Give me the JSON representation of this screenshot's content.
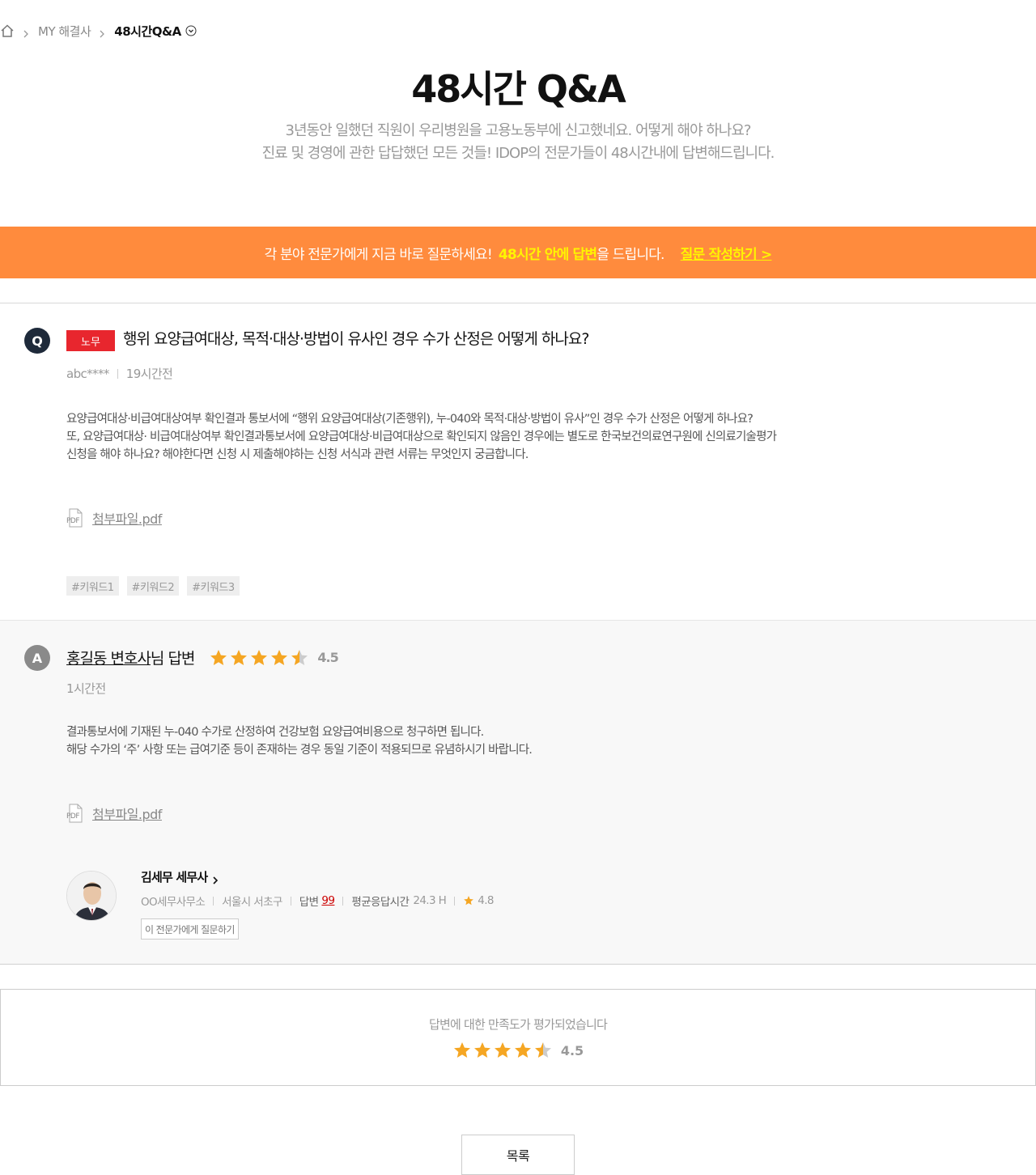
{
  "breadcrumb": {
    "items": [
      "MY 해결사",
      "48시간Q&A"
    ]
  },
  "header": {
    "title": "48시간 Q&A",
    "subtitle_line1": "3년동안 일했던 직원이 우리병원을 고용노동부에 신고했네요. 어떻게 해야 하나요?",
    "subtitle_line2": "진료 및 경영에 관한 답답했던 모든 것들! IDOP의 전문가들이 48시간내에 답변해드립니다."
  },
  "banner": {
    "text": "각 분야 전문가에게 지금 바로 질문하세요!",
    "highlight": "48시간 안에 답변",
    "highlight_rest": "을 드립니다.",
    "link": "질문 작성하기 >"
  },
  "question": {
    "badge": "Q",
    "category": "노무",
    "title": "행위 요양급여대상, 목적·대상·방법이 유사인 경우 수가 산정은 어떻게 하나요?",
    "author": "abc****",
    "time": "19시간전",
    "body_lines": [
      "요양급여대상·비급여대상여부 확인결과 통보서에 “행위 요양급여대상(기존행위), 누-040와 목적·대상·방법이 유사”인 경우 수가 산정은 어떻게 하나요?",
      "또, 요양급여대상· 비급여대상여부 확인결과통보서에 요양급여대상·비급여대상으로 확인되지 않음인 경우에는 별도로 한국보건의료연구원에 신의료기술평가",
      "신청을 해야 하나요? 해야한다면 신청 시 제출해야하는 신청 서식과 관련 서류는 무엇인지 궁금합니다."
    ],
    "attachment": "첨부파일.pdf",
    "pdf_label": "PDF",
    "tags": [
      "#키워드1",
      "#키워드2",
      "#키워드3"
    ]
  },
  "answer": {
    "badge": "A",
    "expert_name": "홍길동 변호사",
    "suffix": " 님 답변",
    "rating": 4.5,
    "rating_label": "4.5",
    "time": "1시간전",
    "body_lines": [
      "결과통보서에 기재된 누-040 수가로 산정하여 건강보험 요양급여비용으로 청구하면 됩니다.",
      "해당 수가의 ‘주’ 사항 또는 급여기준 등이 존재하는 경우 동일 기준이 적용되므로  유념하시기 바랍니다."
    ],
    "attachment": "첨부파일.pdf",
    "pdf_label": "PDF"
  },
  "expert_card": {
    "name": "김세무 세무사",
    "office": "OO세무사무소",
    "location": "서울시 서초구",
    "answers_label": "답변",
    "answers_count": "99",
    "avg_time_label": "평균응답시간",
    "avg_time": "24.3 H",
    "rating": "4.8",
    "ask_button": "이 전문가에게 질문하기"
  },
  "satisfaction": {
    "text": "답변에 대한 만족도가 평가되었습니다",
    "rating": 4.5,
    "rating_label": "4.5"
  },
  "footer": {
    "list_button": "목록"
  },
  "colors": {
    "banner": "#ff8b3d",
    "banner_highlight": "#fff500",
    "category_tag": "#e8262e",
    "star": "#f5a623",
    "q_badge": "#1e2a3a",
    "a_badge": "#8a8a8a"
  }
}
